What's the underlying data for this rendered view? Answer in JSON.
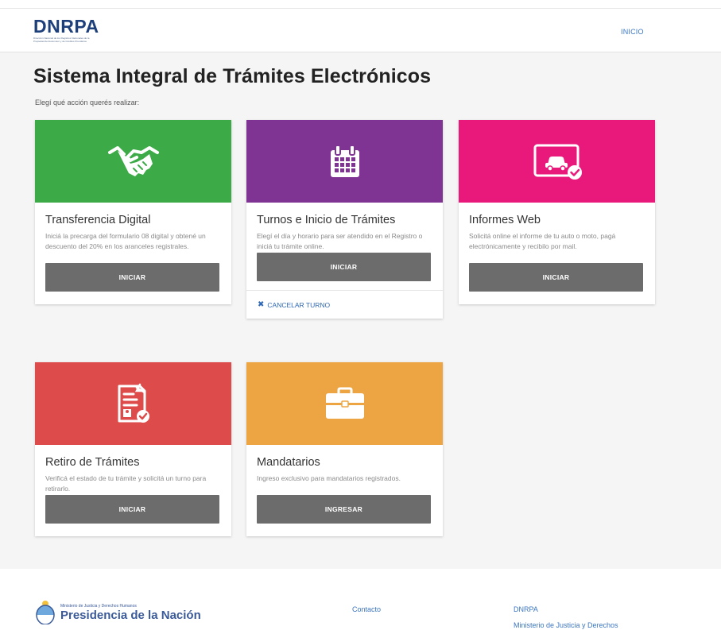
{
  "header": {
    "logo_text": "DNRPA",
    "logo_sub_lines": [
      "Dirección Nacional de los Registros Nacionales de la",
      "Propiedad del Automotor y de Créditos Prendarios"
    ],
    "nav_inicio": "INICIO"
  },
  "main": {
    "title": "Sistema Integral de Trámites Electrónicos",
    "subtitle": "Elegí qué acción querés realizar:"
  },
  "cards": [
    {
      "title": "Transferencia Digital",
      "description": "Iniciá la precarga del formulario 08 digital y obtené un descuento del 20% en los aranceles registrales.",
      "button": "INICIAR",
      "color": "#3cab47",
      "icon": "handshake-icon"
    },
    {
      "title": "Turnos e Inicio de Trámites",
      "description": "Elegí el día y horario para ser atendido en el Registro o iniciá tu trámite online.",
      "button": "INICIAR",
      "footer_link": "CANCELAR TURNO",
      "color": "#7f3494",
      "icon": "calendar-icon"
    },
    {
      "title": "Informes Web",
      "description": "Solicitá online el informe de tu auto o moto, pagá electrónicamente y recibilo por mail.",
      "button": "INICIAR",
      "color": "#e8197b",
      "icon": "car-report-icon"
    },
    {
      "title": "Retiro de Trámites",
      "description": "Verificá el estado de tu trámite y solicitá un turno para retirarlo.",
      "button": "INICIAR",
      "color": "#dd4b4b",
      "icon": "document-check-icon"
    },
    {
      "title": "Mandatarios",
      "description": "Ingreso exclusivo para mandatarios registrados.",
      "button": "INGRESAR",
      "color": "#eda543",
      "icon": "briefcase-icon"
    }
  ],
  "footer": {
    "brand_small": "Ministerio de Justicia y Derechos Humanos",
    "brand_big": "Presidencia de la Nación",
    "contact": "Contacto",
    "dnrpa": "DNRPA",
    "ministerio": "Ministerio de Justicia y Derechos"
  }
}
